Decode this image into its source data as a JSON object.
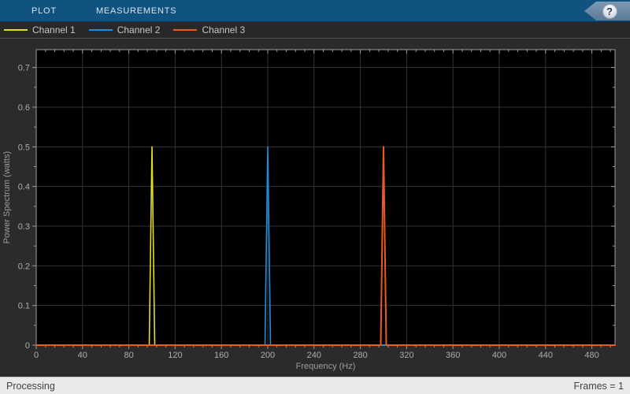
{
  "toolbar": {
    "tabs": [
      {
        "label": "PLOT"
      },
      {
        "label": "MEASUREMENTS"
      }
    ],
    "help_label": "?"
  },
  "legend": {
    "items": [
      {
        "label": "Channel 1",
        "color": "#e3df1c"
      },
      {
        "label": "Channel 2",
        "color": "#1f8fdd"
      },
      {
        "label": "Channel 3",
        "color": "#eb5a1e"
      }
    ]
  },
  "status_bar": {
    "left": "Processing",
    "right": "Frames = 1"
  },
  "colors": {
    "toolbar_bg": "#115380",
    "plot_bg": "#000000",
    "panel_bg": "#2b2b2b",
    "grid": "#333333",
    "spine": "#9e9e9e",
    "tick_label": "#adadad",
    "axis_label": "#9c9c9c"
  },
  "chart_data": {
    "type": "line",
    "title": "",
    "xlabel": "Frequency (Hz)",
    "ylabel": "Power Spectrum (watts)",
    "xlim": [
      0,
      500
    ],
    "ylim": [
      0,
      0.745
    ],
    "xticks": [
      0,
      40,
      80,
      120,
      160,
      200,
      240,
      280,
      320,
      360,
      400,
      440,
      480
    ],
    "yticks": [
      0,
      0.1,
      0.2,
      0.3,
      0.4,
      0.5,
      0.6,
      0.7
    ],
    "x_minor_step": 8,
    "y_minor_step": 0.05,
    "grid": true,
    "legend_position": "top-left",
    "series": [
      {
        "name": "Channel 1",
        "color": "#e3df1c",
        "peak_hz": 100,
        "peak_watts": 0.5,
        "baseline_watts": 0
      },
      {
        "name": "Channel 2",
        "color": "#1f8fdd",
        "peak_hz": 200,
        "peak_watts": 0.5,
        "baseline_watts": 0
      },
      {
        "name": "Channel 3",
        "color": "#eb5a1e",
        "peak_hz": 300,
        "peak_watts": 0.5,
        "baseline_watts": 0
      }
    ]
  }
}
